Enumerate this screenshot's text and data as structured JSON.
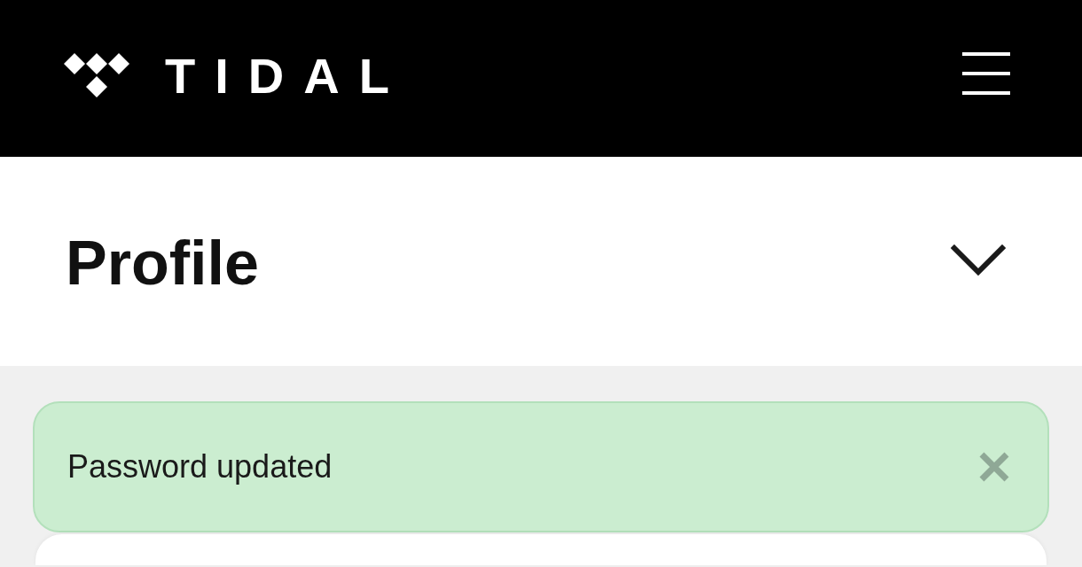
{
  "header": {
    "logo_text": "TIDAL"
  },
  "section": {
    "title": "Profile",
    "expanded": false
  },
  "alert": {
    "kind": "success",
    "message": "Password updated"
  }
}
